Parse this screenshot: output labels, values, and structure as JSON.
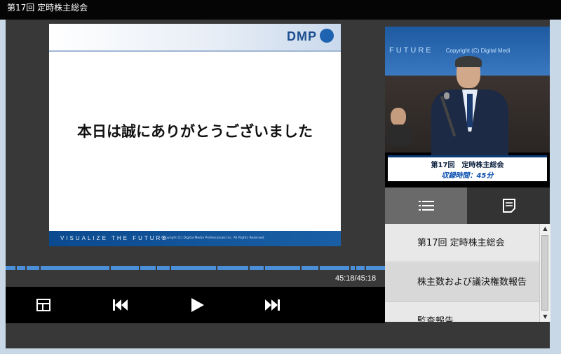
{
  "window": {
    "title": "第17回 定時株主総会"
  },
  "slide": {
    "logo": "DMP",
    "message": "本日は誠にありがとうございました",
    "footer_tagline": "VISUALIZE THE FUTURE",
    "footer_copyright": "Copyright (C) Digital Media Professionals Inc. All Rights Reserved."
  },
  "player": {
    "time": "45:18/45:18",
    "progress": 1.0,
    "controls": {
      "layout_icon": "layout-icon",
      "prev_icon": "skip-back-icon",
      "play_icon": "play-icon",
      "next_icon": "skip-forward-icon"
    },
    "accent_color": "#4a8fd8"
  },
  "video": {
    "banner_text": "FUTURE",
    "banner_right": "Copyright (C) Digital Medi",
    "caption_title": "第17回　定時株主総会",
    "caption_sub": "収録時間：45分"
  },
  "side_tabs": [
    {
      "icon": "list-icon",
      "active": true
    },
    {
      "icon": "notes-icon",
      "active": false
    }
  ],
  "toc": {
    "items": [
      {
        "label": "第17回 定時株主総会"
      },
      {
        "label": "株主数および議決権数報告"
      },
      {
        "label": "監査報告"
      }
    ]
  }
}
